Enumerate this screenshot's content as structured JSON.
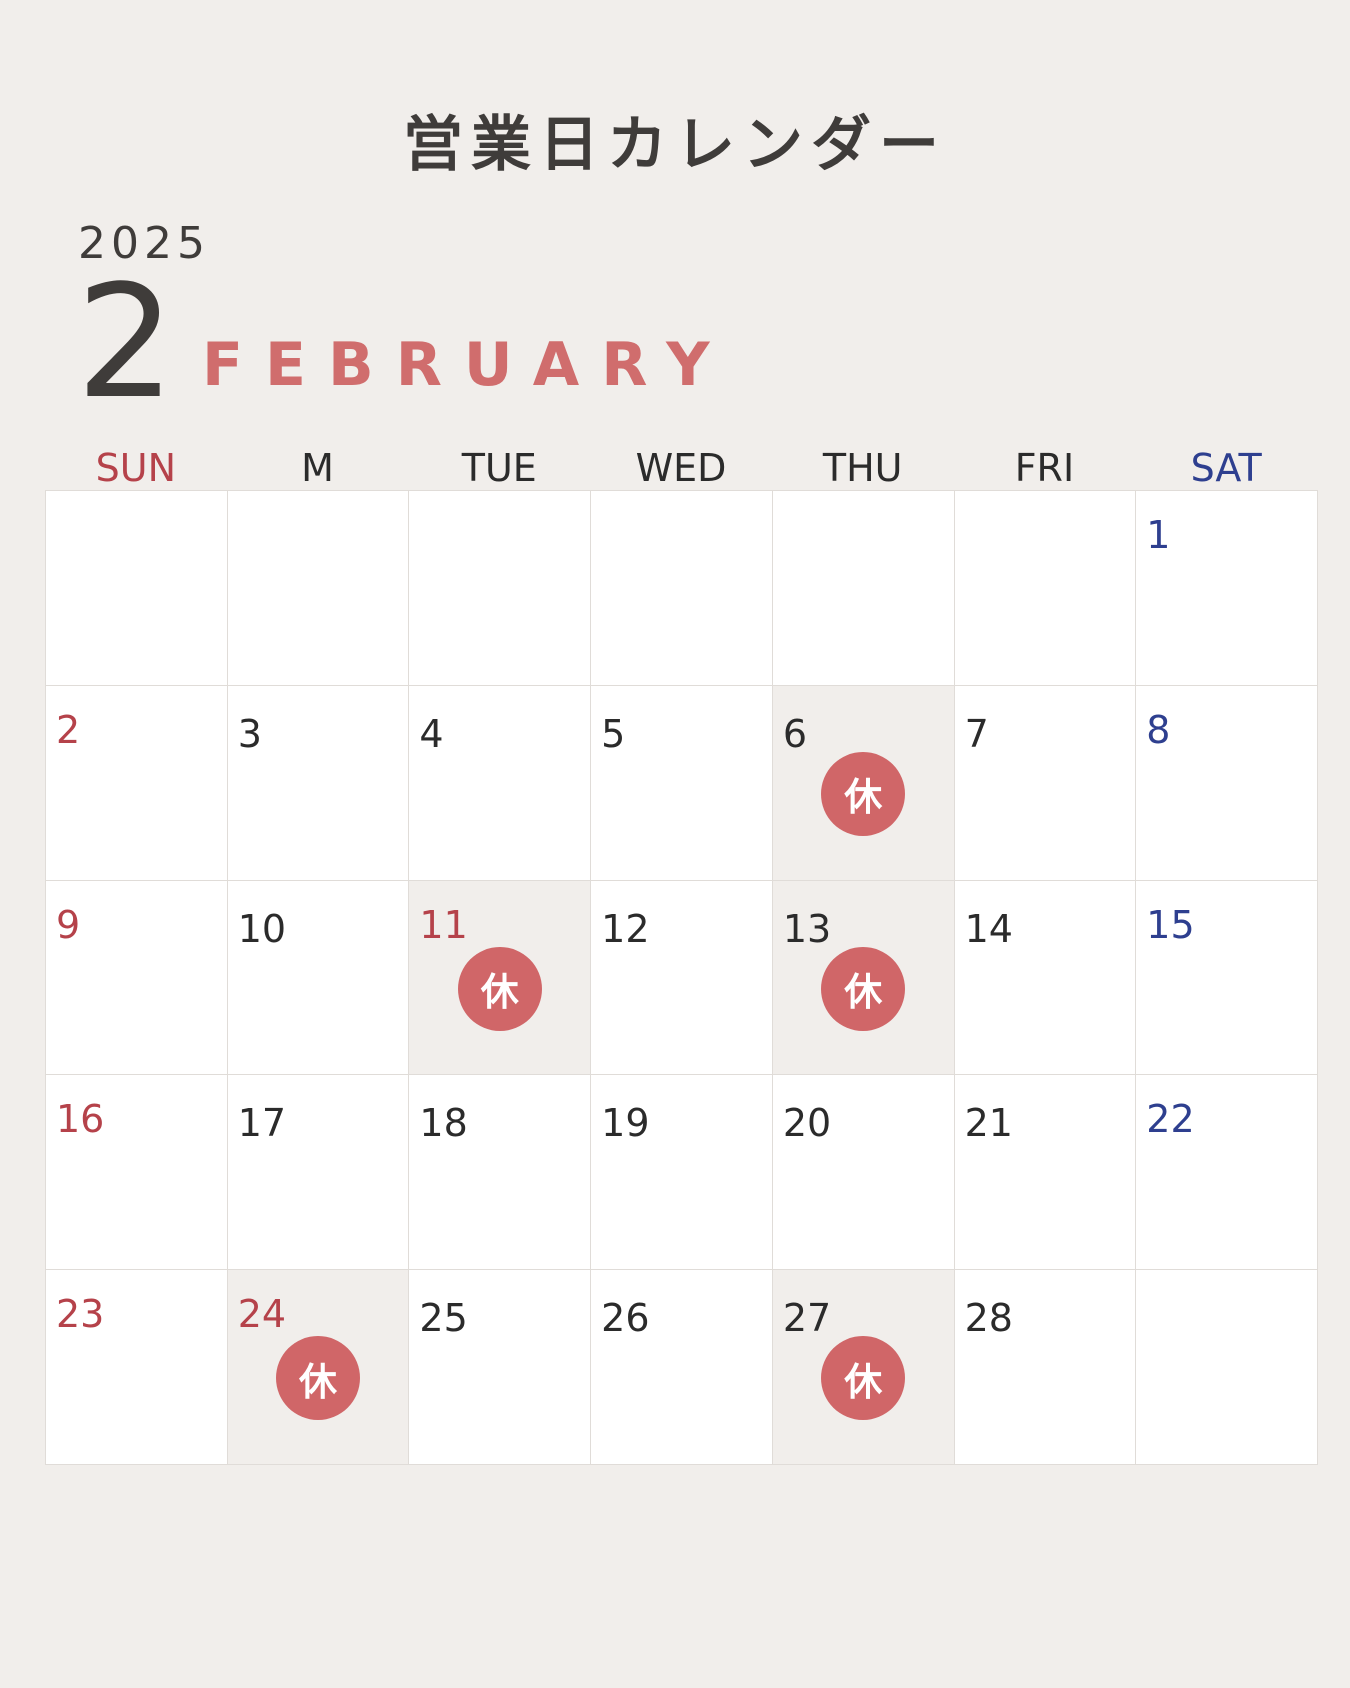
{
  "title": "営業日カレンダー",
  "year": "2025",
  "month_number": "2",
  "month_name": "FEBRUARY",
  "closed_label": "休",
  "colors": {
    "background": "#f1eeeb",
    "accent": "#d06d6d",
    "sunday": "#b5424a",
    "saturday": "#2e3f8f",
    "closed_badge": "#d06668"
  },
  "weekdays": [
    {
      "label": "SUN",
      "type": "sun"
    },
    {
      "label": "MON",
      "type": "weekday"
    },
    {
      "label": "TUE",
      "type": "weekday"
    },
    {
      "label": "WED",
      "type": "weekday"
    },
    {
      "label": "THU",
      "type": "weekday"
    },
    {
      "label": "FRI",
      "type": "weekday"
    },
    {
      "label": "SAT",
      "type": "sat"
    }
  ],
  "weeks": [
    [
      {
        "day": "",
        "type": "blank",
        "closed": false
      },
      {
        "day": "",
        "type": "blank",
        "closed": false
      },
      {
        "day": "",
        "type": "blank",
        "closed": false
      },
      {
        "day": "",
        "type": "blank",
        "closed": false
      },
      {
        "day": "",
        "type": "blank",
        "closed": false
      },
      {
        "day": "",
        "type": "blank",
        "closed": false
      },
      {
        "day": "1",
        "type": "sat",
        "closed": false
      }
    ],
    [
      {
        "day": "2",
        "type": "sun",
        "closed": false
      },
      {
        "day": "3",
        "type": "weekday",
        "closed": false
      },
      {
        "day": "4",
        "type": "weekday",
        "closed": false
      },
      {
        "day": "5",
        "type": "weekday",
        "closed": false
      },
      {
        "day": "6",
        "type": "weekday",
        "closed": true
      },
      {
        "day": "7",
        "type": "weekday",
        "closed": false
      },
      {
        "day": "8",
        "type": "sat",
        "closed": false
      }
    ],
    [
      {
        "day": "9",
        "type": "sun",
        "closed": false
      },
      {
        "day": "10",
        "type": "weekday",
        "closed": false
      },
      {
        "day": "11",
        "type": "hol",
        "closed": true
      },
      {
        "day": "12",
        "type": "weekday",
        "closed": false
      },
      {
        "day": "13",
        "type": "weekday",
        "closed": true
      },
      {
        "day": "14",
        "type": "weekday",
        "closed": false
      },
      {
        "day": "15",
        "type": "sat",
        "closed": false
      }
    ],
    [
      {
        "day": "16",
        "type": "sun",
        "closed": false
      },
      {
        "day": "17",
        "type": "weekday",
        "closed": false
      },
      {
        "day": "18",
        "type": "weekday",
        "closed": false
      },
      {
        "day": "19",
        "type": "weekday",
        "closed": false
      },
      {
        "day": "20",
        "type": "weekday",
        "closed": false
      },
      {
        "day": "21",
        "type": "weekday",
        "closed": false
      },
      {
        "day": "22",
        "type": "sat",
        "closed": false
      }
    ],
    [
      {
        "day": "23",
        "type": "sun",
        "closed": false
      },
      {
        "day": "24",
        "type": "hol",
        "closed": true
      },
      {
        "day": "25",
        "type": "weekday",
        "closed": false
      },
      {
        "day": "26",
        "type": "weekday",
        "closed": false
      },
      {
        "day": "27",
        "type": "weekday",
        "closed": true
      },
      {
        "day": "28",
        "type": "weekday",
        "closed": false
      },
      {
        "day": "",
        "type": "blank",
        "closed": false
      }
    ]
  ]
}
